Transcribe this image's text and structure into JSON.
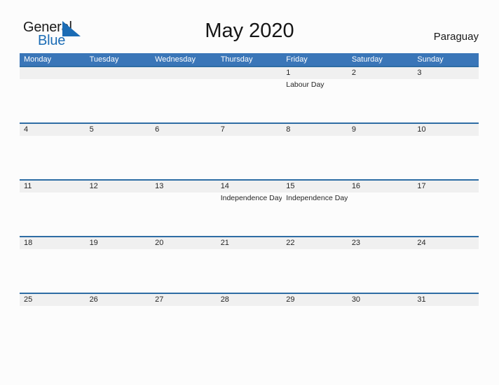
{
  "brand": {
    "name_part1": "General",
    "name_part2": "Blue",
    "flag_icon": "flag-triangle-icon",
    "flag_color": "#1b6cb5"
  },
  "header": {
    "title": "May 2020",
    "country": "Paraguay"
  },
  "theme": {
    "header_blue": "#3a76b8",
    "divider_blue": "#2e6da4",
    "date_band_gray": "#f0f0f0",
    "page_background": "#fcfcfc",
    "logo_blue": "#1b6cb5",
    "text_dark": "#262626"
  },
  "calendar": {
    "weekdays": [
      "Monday",
      "Tuesday",
      "Wednesday",
      "Thursday",
      "Friday",
      "Saturday",
      "Sunday"
    ],
    "weeks": [
      {
        "days": [
          {
            "date": "",
            "event": ""
          },
          {
            "date": "",
            "event": ""
          },
          {
            "date": "",
            "event": ""
          },
          {
            "date": "",
            "event": ""
          },
          {
            "date": "1",
            "event": "Labour Day"
          },
          {
            "date": "2",
            "event": ""
          },
          {
            "date": "3",
            "event": ""
          }
        ]
      },
      {
        "days": [
          {
            "date": "4",
            "event": ""
          },
          {
            "date": "5",
            "event": ""
          },
          {
            "date": "6",
            "event": ""
          },
          {
            "date": "7",
            "event": ""
          },
          {
            "date": "8",
            "event": ""
          },
          {
            "date": "9",
            "event": ""
          },
          {
            "date": "10",
            "event": ""
          }
        ]
      },
      {
        "days": [
          {
            "date": "11",
            "event": ""
          },
          {
            "date": "12",
            "event": ""
          },
          {
            "date": "13",
            "event": ""
          },
          {
            "date": "14",
            "event": "Independence Day"
          },
          {
            "date": "15",
            "event": "Independence Day"
          },
          {
            "date": "16",
            "event": ""
          },
          {
            "date": "17",
            "event": ""
          }
        ]
      },
      {
        "days": [
          {
            "date": "18",
            "event": ""
          },
          {
            "date": "19",
            "event": ""
          },
          {
            "date": "20",
            "event": ""
          },
          {
            "date": "21",
            "event": ""
          },
          {
            "date": "22",
            "event": ""
          },
          {
            "date": "23",
            "event": ""
          },
          {
            "date": "24",
            "event": ""
          }
        ]
      },
      {
        "days": [
          {
            "date": "25",
            "event": ""
          },
          {
            "date": "26",
            "event": ""
          },
          {
            "date": "27",
            "event": ""
          },
          {
            "date": "28",
            "event": ""
          },
          {
            "date": "29",
            "event": ""
          },
          {
            "date": "30",
            "event": ""
          },
          {
            "date": "31",
            "event": ""
          }
        ]
      }
    ]
  }
}
